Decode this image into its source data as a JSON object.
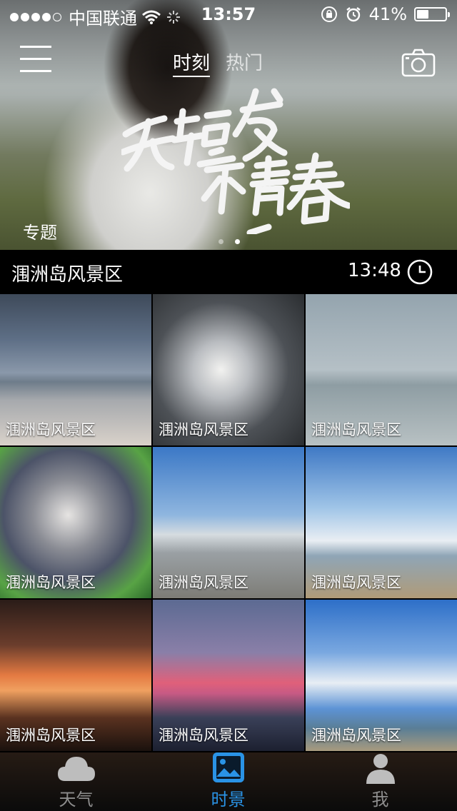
{
  "status_bar": {
    "carrier": "中国联通",
    "time": "13:57",
    "battery": "41%",
    "battery_level": 0.41,
    "signal_dots_filled": 4,
    "signal_dots_total": 5
  },
  "header": {
    "tabs": [
      {
        "label": "时刻",
        "active": true
      },
      {
        "label": "热门",
        "active": false
      }
    ],
    "menu_icon": "hamburger-icon",
    "camera_icon": "camera-icon"
  },
  "banner": {
    "title_art": "无短发不青春",
    "tag": "专题",
    "pages": 2,
    "current_page": 2
  },
  "location_bar": {
    "name": "涠洲岛风景区",
    "time": "13:48",
    "icon": "clock-icon"
  },
  "photos": [
    {
      "label": "涠洲岛风景区"
    },
    {
      "label": "涠洲岛风景区"
    },
    {
      "label": "涠洲岛风景区"
    },
    {
      "label": "涠洲岛风景区"
    },
    {
      "label": "涠洲岛风景区"
    },
    {
      "label": "涠洲岛风景区"
    },
    {
      "label": "涠洲岛风景区"
    },
    {
      "label": "涠洲岛风景区"
    },
    {
      "label": "涠洲岛风景区"
    }
  ],
  "tab_bar": {
    "items": [
      {
        "label": "天气",
        "icon": "cloud-icon",
        "active": false
      },
      {
        "label": "时景",
        "icon": "picture-icon",
        "active": true
      },
      {
        "label": "我",
        "icon": "person-icon",
        "active": false
      }
    ],
    "active_color": "#2a93e6",
    "inactive_color": "#8d8d8d"
  }
}
